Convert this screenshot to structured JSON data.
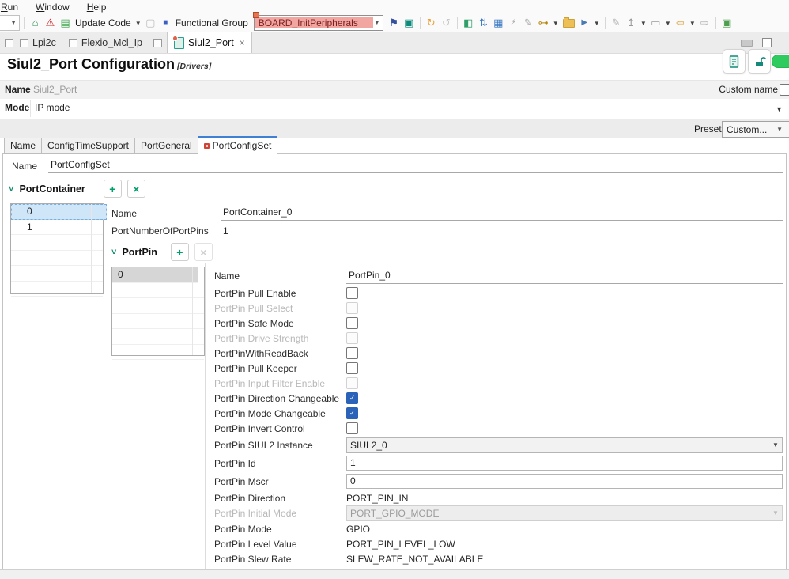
{
  "glyphs": {
    "dropdown": "▼",
    "caret": "▾",
    "plus": "+",
    "close": "×",
    "chevron": "˅",
    "check": "✓"
  },
  "menu": {
    "items": [
      {
        "label": "Run"
      },
      {
        "label": "Window"
      },
      {
        "label": "Help"
      }
    ]
  },
  "toolbar": {
    "update_code_label": "Update Code",
    "functional_group_label": "Functional Group",
    "functional_group_value": "BOARD_InitPeripherals",
    "icons": [
      {
        "name": "home-icon",
        "glyph": "⌂"
      },
      {
        "name": "error-marker-icon",
        "glyph": "⚠"
      },
      {
        "name": "update-code-icon",
        "glyph": "▤"
      },
      {
        "name": "save-icon",
        "glyph": "▢"
      },
      {
        "name": "board-view-icon",
        "glyph": "■"
      },
      {
        "name": "flag-icon",
        "glyph": "⚑"
      },
      {
        "name": "console-icon",
        "glyph": "▣"
      },
      {
        "name": "refresh-icon",
        "glyph": "↻"
      },
      {
        "name": "undo-icon",
        "glyph": "↺"
      },
      {
        "name": "plugin-icon",
        "glyph": "◧"
      },
      {
        "name": "sort-icon",
        "glyph": "⇅"
      },
      {
        "name": "terminal-icon",
        "glyph": "▦"
      },
      {
        "name": "debug-attach-icon",
        "glyph": "⚡"
      },
      {
        "name": "pencil-icon",
        "glyph": "✎"
      },
      {
        "name": "key-icon",
        "glyph": "⊶"
      },
      {
        "name": "launch-icon",
        "glyph": "▶"
      },
      {
        "name": "edit-icon",
        "glyph": "✎"
      },
      {
        "name": "export-icon",
        "glyph": "↥"
      },
      {
        "name": "window-icon",
        "glyph": "▭"
      },
      {
        "name": "back-icon",
        "glyph": "⇦"
      },
      {
        "name": "forward-icon",
        "glyph": "⇨"
      },
      {
        "name": "new-window-icon",
        "glyph": "▣"
      },
      {
        "name": "open-folder-icon",
        "glyph": ""
      }
    ]
  },
  "editor_tabs": {
    "tabs": [
      {
        "label": "Lpi2c"
      },
      {
        "label": "Flexio_Mcl_Ip"
      },
      {
        "label": "Siul2_Port"
      }
    ]
  },
  "header": {
    "title": "Siul2_Port Configuration",
    "subtitle": "[Drivers]"
  },
  "general": {
    "name_label": "Name",
    "name_value": "Siul2_Port",
    "custom_name_label": "Custom name",
    "mode_label": "Mode",
    "mode_value": "IP mode",
    "preset_label": "Preset",
    "preset_value": "Custom..."
  },
  "config_tabs": [
    {
      "label": "Name"
    },
    {
      "label": "ConfigTimeSupport"
    },
    {
      "label": "PortGeneral"
    },
    {
      "label": "PortConfigSet"
    }
  ],
  "config": {
    "name_label": "Name",
    "name_value": "PortConfigSet"
  },
  "port_container": {
    "title": "PortContainer",
    "rows": [
      {
        "label": "0",
        "selected": true
      },
      {
        "label": "1",
        "selected": false
      }
    ],
    "name_label": "Name",
    "name_value": "PortContainer_0",
    "pins_label": "PortNumberOfPortPins",
    "pins_value": "1"
  },
  "port_pin": {
    "title": "PortPin",
    "rows": [
      {
        "label": "0",
        "selected": true
      }
    ],
    "fields": [
      {
        "label": "Name",
        "type": "input",
        "value": "PortPin_0",
        "enabled": true
      },
      {
        "label": "PortPin Pull Enable",
        "type": "checkbox",
        "checked": false,
        "enabled": true
      },
      {
        "label": "PortPin Pull Select",
        "type": "checkbox",
        "checked": false,
        "enabled": false
      },
      {
        "label": "PortPin Safe Mode",
        "type": "checkbox",
        "checked": false,
        "enabled": true
      },
      {
        "label": "PortPin Drive Strength",
        "type": "checkbox",
        "checked": false,
        "enabled": false
      },
      {
        "label": "PortPinWithReadBack",
        "type": "checkbox",
        "checked": false,
        "enabled": true
      },
      {
        "label": "PortPin Pull Keeper",
        "type": "checkbox",
        "checked": false,
        "enabled": true
      },
      {
        "label": "PortPin Input Filter Enable",
        "type": "checkbox",
        "checked": false,
        "enabled": false
      },
      {
        "label": "PortPin Direction Changeable",
        "type": "checkbox",
        "checked": true,
        "enabled": true
      },
      {
        "label": "PortPin Mode Changeable",
        "type": "checkbox",
        "checked": true,
        "enabled": true
      },
      {
        "label": "PortPin Invert Control",
        "type": "checkbox",
        "checked": false,
        "enabled": true
      },
      {
        "label": "PortPin SIUL2 Instance",
        "type": "combo",
        "value": "SIUL2_0",
        "enabled": true
      },
      {
        "label": "PortPin Id",
        "type": "input",
        "value": "1",
        "enabled": true
      },
      {
        "label": "PortPin Mscr",
        "type": "input",
        "value": "0",
        "enabled": true
      },
      {
        "label": "PortPin Direction",
        "type": "text",
        "value": "PORT_PIN_IN",
        "enabled": true
      },
      {
        "label": "PortPin Initial Mode",
        "type": "combo",
        "value": "PORT_GPIO_MODE",
        "enabled": false
      },
      {
        "label": "PortPin Mode",
        "type": "text",
        "value": "GPIO",
        "enabled": true
      },
      {
        "label": "PortPin Level Value",
        "type": "text",
        "value": "PORT_PIN_LEVEL_LOW",
        "enabled": true
      },
      {
        "label": "PortPin Slew Rate",
        "type": "text",
        "value": "SLEW_RATE_NOT_AVAILABLE",
        "enabled": true
      }
    ]
  },
  "colors": {
    "accent_green": "#00a06a",
    "checked_blue": "#2a63b8",
    "selected_row_blue": "#cfe6f9",
    "functional_group_bg": "#f2a6a2",
    "functional_group_text": "#7a1f1f",
    "toggle_on": "#2ecc5e",
    "tab_accent": "#3f7fd4",
    "error_red": "#d04437"
  }
}
